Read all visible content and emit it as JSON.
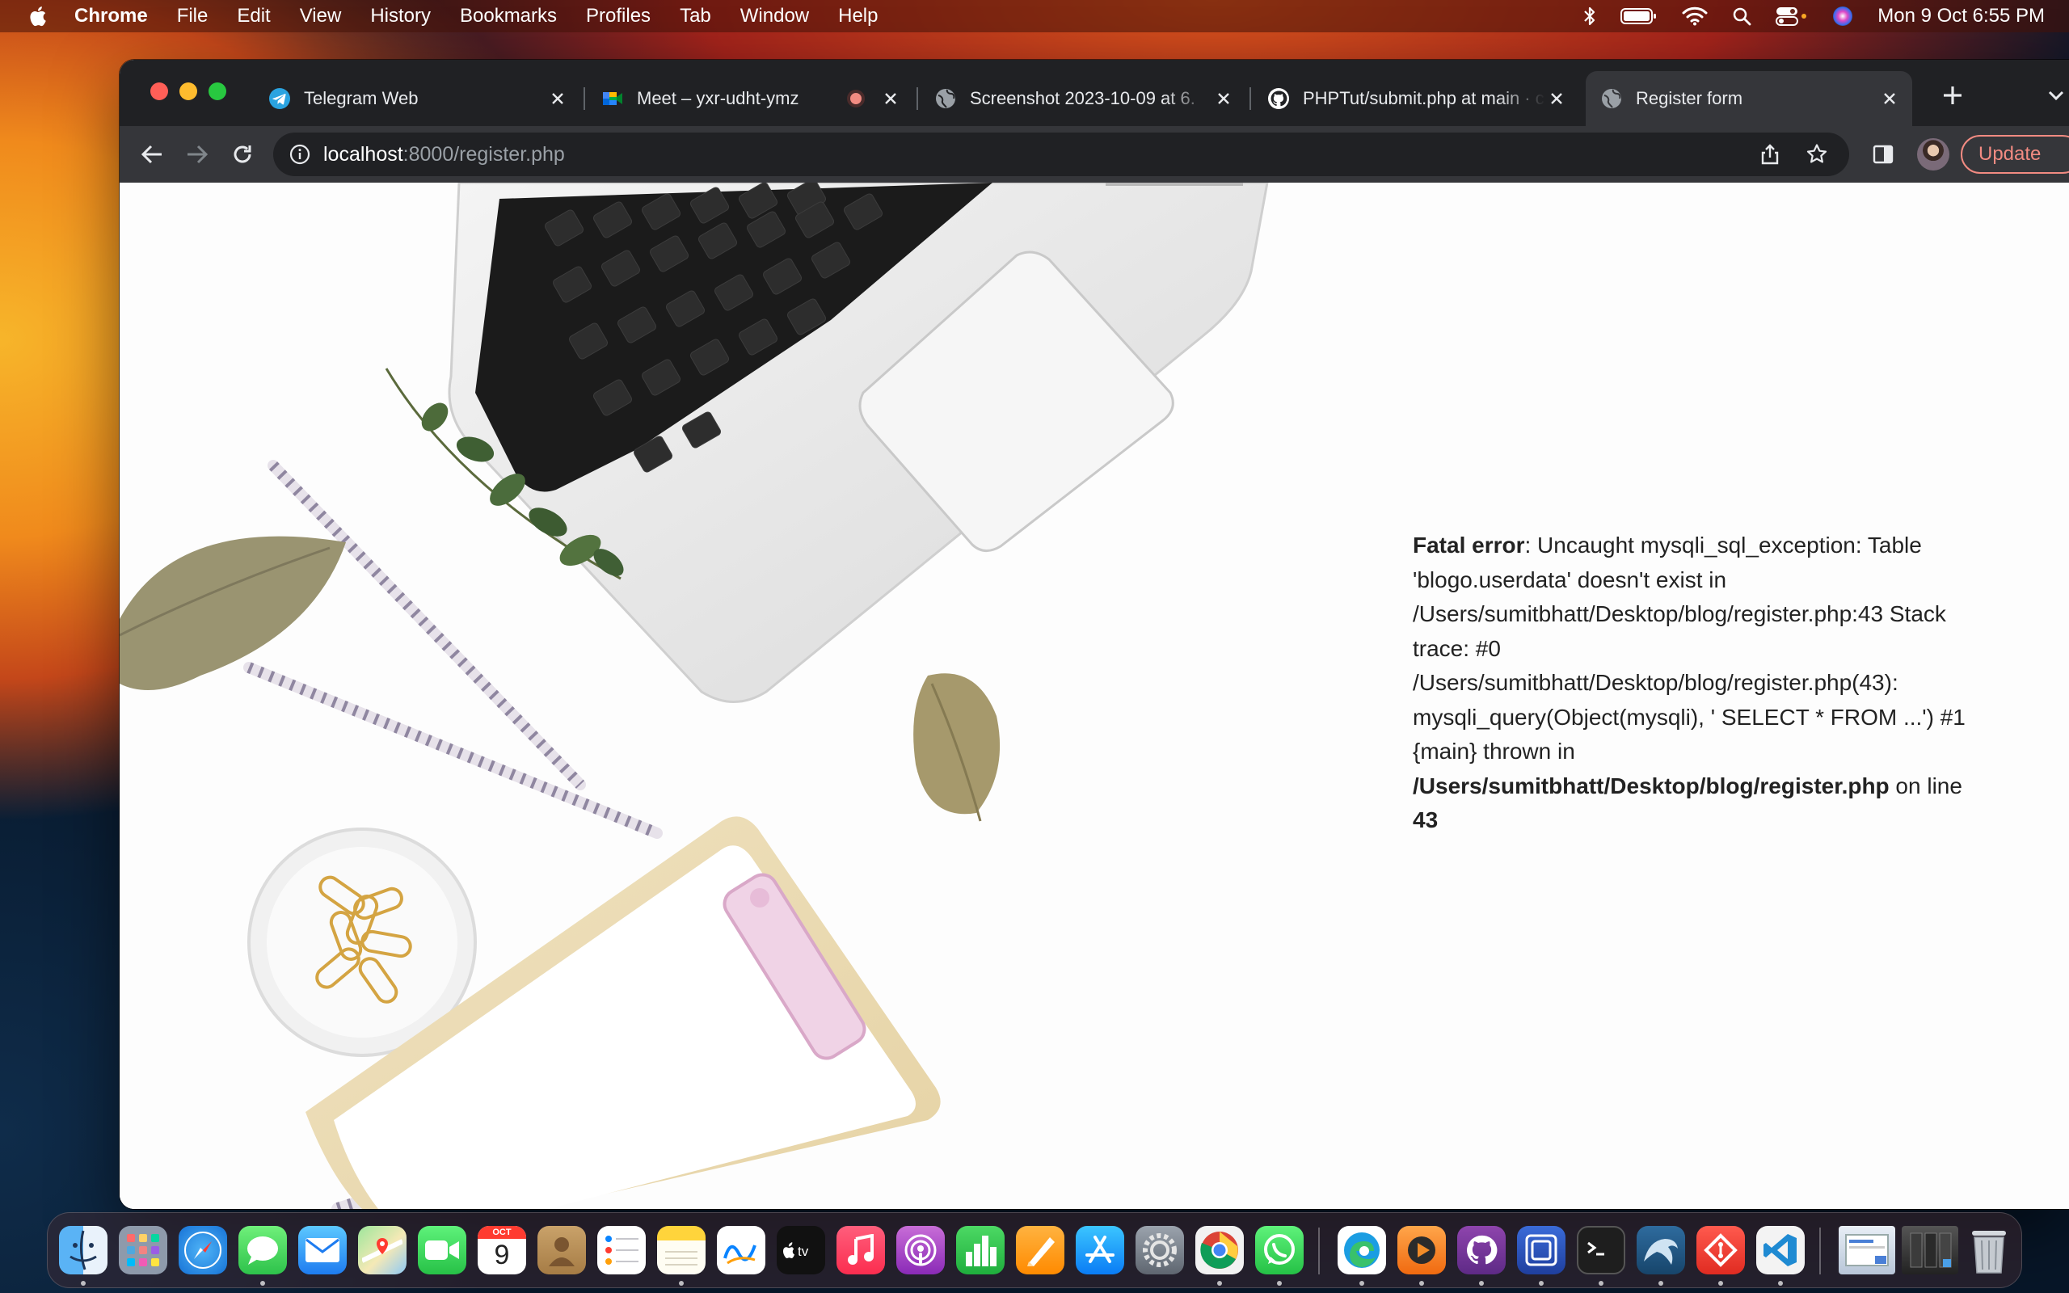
{
  "menubar": {
    "app_name": "Chrome",
    "items": [
      "File",
      "Edit",
      "View",
      "History",
      "Bookmarks",
      "Profiles",
      "Tab",
      "Window",
      "Help"
    ],
    "clock": "Mon 9 Oct  6:55 PM"
  },
  "tabs": [
    {
      "title": "Telegram Web",
      "icon": "telegram-icon"
    },
    {
      "title": "Meet – yxr-udht-ymz",
      "icon": "google-meet-icon",
      "recording": true
    },
    {
      "title": "Screenshot 2023-10-09 at 6.",
      "icon": "globe-icon"
    },
    {
      "title": "PHPTut/submit.php at main · c",
      "icon": "github-icon"
    },
    {
      "title": "Register form",
      "icon": "globe-icon",
      "active": true
    }
  ],
  "address_bar": {
    "host": "localhost",
    "path": ":8000/register.php"
  },
  "toolbar": {
    "update_label": "Update"
  },
  "error": {
    "label": "Fatal error",
    "message": ": Uncaught mysqli_sql_exception: Table 'blogo.userdata' doesn't exist in /Users/sumitbhatt/Desktop/blog/register.php:43 Stack trace: #0 /Users/sumitbhatt/Desktop/blog/register.php(43): mysqli_query(Object(mysqli), ' SELECT * FROM ...') #1 {main} thrown in ",
    "file": "/Users/sumitbhatt/Desktop/blog/register.php",
    "on_line": " on line ",
    "line": "43"
  },
  "calendar_icon": {
    "month": "OCT",
    "day": "9"
  },
  "dock": {
    "apps": [
      "finder",
      "launchpad",
      "safari",
      "messages",
      "mail",
      "maps",
      "facetime",
      "calendar",
      "contacts",
      "reminders",
      "notes",
      "freeform",
      "apple-tv",
      "music",
      "podcasts",
      "numbers",
      "pages",
      "app-store",
      "system-settings",
      "chrome",
      "whatsapp",
      "edge",
      "infuse",
      "github-desktop",
      "screen-app",
      "terminal",
      "mysql-workbench",
      "git-app",
      "vscode",
      "downloads-stack",
      "documents-stack",
      "trash"
    ]
  }
}
